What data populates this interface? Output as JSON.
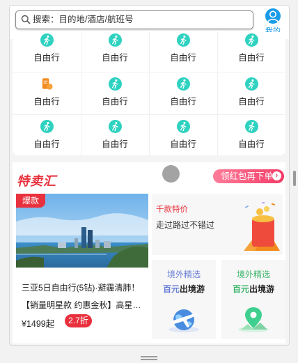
{
  "header": {
    "search_placeholder": "搜索：目的地/酒店/航班号",
    "mine_label": "我的"
  },
  "grid": {
    "items": [
      {
        "label": "自由行",
        "icon": "hiker-icon"
      },
      {
        "label": "自由行",
        "icon": "hiker-icon"
      },
      {
        "label": "自由行",
        "icon": "hiker-icon"
      },
      {
        "label": "自由行",
        "icon": "hiker-icon"
      },
      {
        "label": "自由行",
        "icon": "document-icon"
      },
      {
        "label": "自由行",
        "icon": "hiker-icon"
      },
      {
        "label": "自由行",
        "icon": "hiker-icon"
      },
      {
        "label": "自由行",
        "icon": "hiker-icon"
      },
      {
        "label": "自由行",
        "icon": "hiker-icon"
      },
      {
        "label": "自由行",
        "icon": "hiker-icon"
      },
      {
        "label": "自由行",
        "icon": "hiker-icon"
      },
      {
        "label": "自由行",
        "icon": "hiker-icon"
      }
    ]
  },
  "special": {
    "title": "特卖汇",
    "coupon_button": "领红包再下单",
    "featured": {
      "badge": "爆款",
      "title": "三亚5日自由行(5钻)·避霾清肺！",
      "subtitle": "【销量明星款 约惠金秋】高星…",
      "price": "¥1499起",
      "discount": "2.7折"
    },
    "deal": {
      "title": "千款特价",
      "subtitle": "走过路过不错过"
    },
    "overseas_a": {
      "title": "境外精选",
      "prefix": "百元",
      "suffix": "出境游"
    },
    "overseas_b": {
      "title": "境外精选",
      "prefix": "百元",
      "suffix": "出境游"
    }
  },
  "colors": {
    "accent_red": "#e8313d",
    "teal_icon": "#2fd2c0",
    "blue": "#1a9be8",
    "orange": "#f28b1e"
  }
}
